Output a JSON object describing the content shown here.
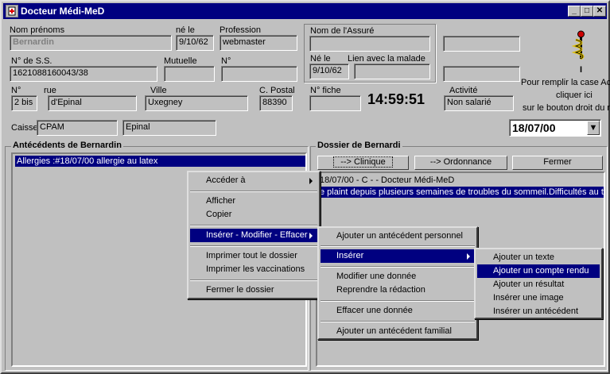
{
  "window": {
    "title": "Docteur Médi-MeD",
    "min": "_",
    "max": "□",
    "close": "✕"
  },
  "patient": {
    "nom_label": "Nom prénoms",
    "nom_value": "Bernardin",
    "ne_le_label": "né le",
    "ne_le_value": "9/10/62",
    "profession_label": "Profession",
    "profession_value": "webmaster",
    "ss_label": "N° de S.S.",
    "ss_value": "1621088160043/38",
    "mutuelle_label": "Mutuelle",
    "n_label": "N°",
    "num_label": "N°",
    "num_value": "2 bis",
    "rue_label": "rue",
    "rue_value": "d'Epinal",
    "ville_label": "Ville",
    "ville_value": "Uxegney",
    "cp_label": "C. Postal",
    "cp_value": "88390",
    "fiche_label": "N° fiche",
    "clock": "14:59:51",
    "activite_label": "Activité",
    "activite_value": "Non salarié",
    "caisse_label": "Caisse",
    "caisse_value": "CPAM",
    "caisse_ville": "Epinal",
    "date_value": "18/07/00"
  },
  "assure": {
    "nom_label": "Nom de l'Assuré",
    "ne_le_label": "Né le",
    "ne_le_value": "9/10/62",
    "lien_label": "Lien avec la malade"
  },
  "hint": {
    "line0": "I",
    "line1": "Pour remplir la case Ac",
    "line2": "cliquer ici",
    "line3": "sur le bouton  droit du r"
  },
  "antecedents": {
    "title": "Antécédents de Bernardin",
    "items": [
      "Allergies :#18/07/00 allergie au latex"
    ]
  },
  "dossier": {
    "title": "Dossier de Bernardi",
    "buttons": {
      "clinique": "--> Clinique",
      "ordonnance": "--> Ordonnance",
      "fermer": "Fermer"
    },
    "lines": [
      "18/07/00 - C -  - Docteur Médi-MeD",
      "e plaint depuis plusieurs semaines de troubles du sommeil.Difficultés au trav"
    ]
  },
  "menu1": {
    "items": [
      "Accéder à",
      "Afficher",
      "Copier",
      "Insérer - Modifier - Effacer",
      "Imprimer tout le dossier",
      "Imprimer les vaccinations",
      "Fermer le dossier"
    ]
  },
  "menu2": {
    "items": [
      "Ajouter un antécédent personnel",
      "Insérer",
      "Modifier une donnée",
      "Reprendre la rédaction",
      "Effacer une donnée",
      "Ajouter un antécédent familial"
    ]
  },
  "menu3": {
    "items": [
      "Ajouter un texte",
      "Ajouter un compte rendu",
      "Ajouter un résultat",
      "Insérer une image",
      "Insérer un antécédent"
    ]
  },
  "colors": {
    "titlebar": "#000080",
    "face": "#c0c0c0",
    "highlight": "#000080"
  }
}
